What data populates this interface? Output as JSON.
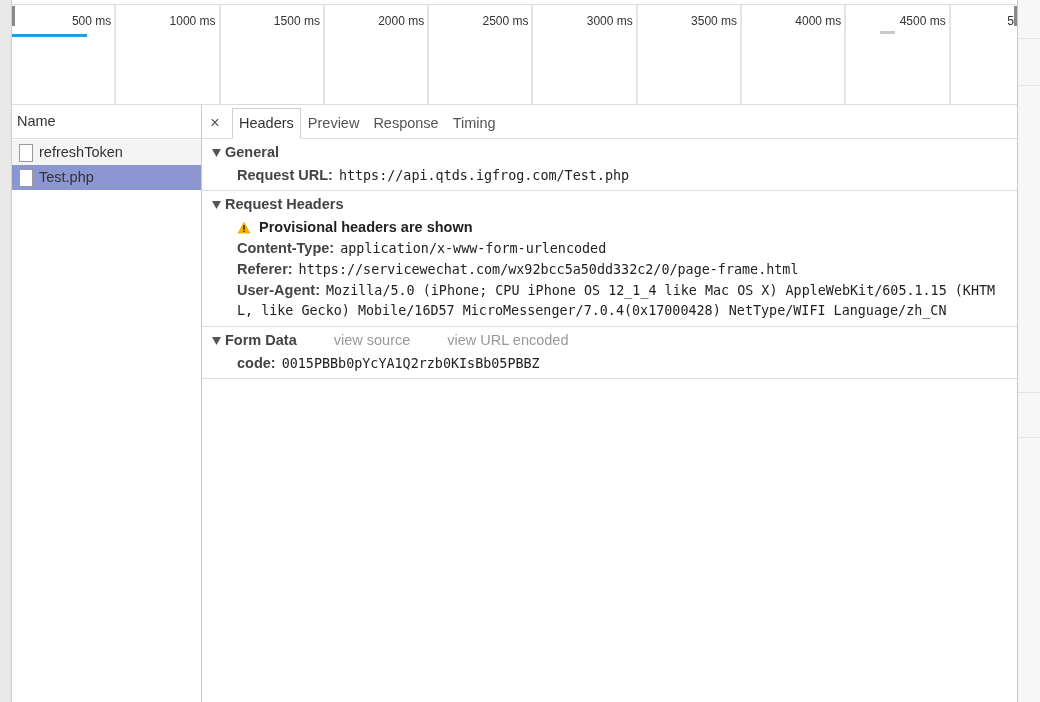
{
  "timeline": {
    "ticks": [
      "500 ms",
      "1000 ms",
      "1500 ms",
      "2000 ms",
      "2500 ms",
      "3000 ms",
      "3500 ms",
      "4000 ms",
      "4500 ms",
      "5"
    ]
  },
  "requests": {
    "column": "Name",
    "items": [
      {
        "name": "refreshToken",
        "selected": false
      },
      {
        "name": "Test.php",
        "selected": true
      }
    ]
  },
  "detail": {
    "close": "×",
    "tabs": [
      {
        "label": "Headers",
        "selected": true
      },
      {
        "label": "Preview",
        "selected": false
      },
      {
        "label": "Response",
        "selected": false
      },
      {
        "label": "Timing",
        "selected": false
      }
    ],
    "sections": [
      {
        "title": "General",
        "expanded": true,
        "rows": [
          {
            "kind": "header",
            "key": "Request URL:",
            "value_lines": [
              "https://api.qtds.igfrog.com/Test.php"
            ]
          }
        ]
      },
      {
        "title": "Request Headers",
        "expanded": true,
        "rows": [
          {
            "kind": "warning",
            "text": "Provisional headers are shown"
          },
          {
            "kind": "header",
            "key": "Content-Type:",
            "value_lines": [
              "application/x-www-form-urlencoded"
            ]
          },
          {
            "kind": "header",
            "key": "Referer:",
            "value_lines": [
              "https://servicewechat.com/wx92bcc5a50dd332c2/0/page-frame.html"
            ]
          },
          {
            "kind": "header",
            "key": "User-Agent:",
            "value_lines": [
              "Mozilla/5.0 (iPhone; CPU iPhone OS 12_1_4 like Mac OS X) AppleWebKit/605.1.15 (KHTM",
              "L, like Gecko) Mobile/16D57 MicroMessenger/7.0.4(0x17000428) NetType/WIFI Language/zh_CN"
            ]
          }
        ]
      },
      {
        "title": "Form Data",
        "expanded": true,
        "links": [
          "view source",
          "view URL encoded"
        ],
        "rows": [
          {
            "kind": "header",
            "key": "code:",
            "value_lines": [
              "0015PBBb0pYcYA1Q2rzb0KIsBb05PBBZ"
            ]
          }
        ]
      }
    ]
  }
}
